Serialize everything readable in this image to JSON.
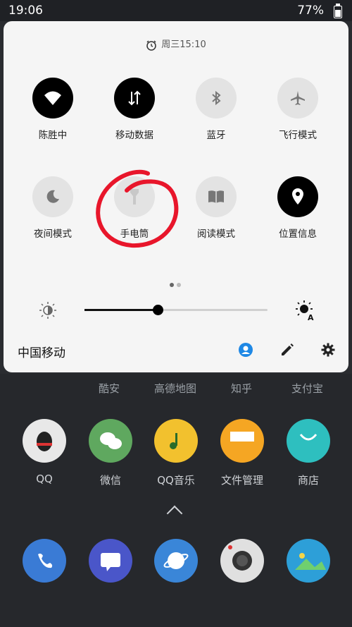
{
  "status_bar": {
    "time": "19:06",
    "battery": "77%",
    "battery_level": 0.77
  },
  "quick_settings": {
    "alarm_text": "周三15:10",
    "tiles": [
      {
        "label": "陈胜中",
        "icon": "wifi-icon",
        "active": true
      },
      {
        "label": "移动数据",
        "icon": "mobile-data-icon",
        "active": true
      },
      {
        "label": "蓝牙",
        "icon": "bluetooth-icon",
        "active": false
      },
      {
        "label": "飞行模式",
        "icon": "airplane-icon",
        "active": false
      },
      {
        "label": "夜间模式",
        "icon": "moon-icon",
        "active": false
      },
      {
        "label": "手电筒",
        "icon": "flashlight-icon",
        "active": false
      },
      {
        "label": "阅读模式",
        "icon": "book-icon",
        "active": false
      },
      {
        "label": "位置信息",
        "icon": "location-icon",
        "active": true
      }
    ],
    "page_count": 2,
    "current_page": 1,
    "brightness_level": 0.4,
    "carrier": "中国移动"
  },
  "home_screen": {
    "row1_labels": [
      "酷安",
      "高德地图",
      "知乎",
      "支付宝"
    ],
    "row2_apps": [
      {
        "label": "QQ",
        "color": "#e8e8e8"
      },
      {
        "label": "微信",
        "color": "#5fa85f"
      },
      {
        "label": "QQ音乐",
        "color": "#f2c12e"
      },
      {
        "label": "文件管理",
        "color": "#f5a623"
      },
      {
        "label": "商店",
        "color": "#2ebfbf"
      }
    ],
    "dock_apps": [
      {
        "name": "phone",
        "color": "#3a7bd5"
      },
      {
        "name": "messages",
        "color": "#4a56c9"
      },
      {
        "name": "browser",
        "color": "#3a86d8"
      },
      {
        "name": "camera",
        "color": "#e0e0e0"
      },
      {
        "name": "gallery",
        "color": "#2d9fd8"
      }
    ]
  },
  "colors": {
    "accent": "#1e88e5",
    "annotation": "#e8162b"
  }
}
